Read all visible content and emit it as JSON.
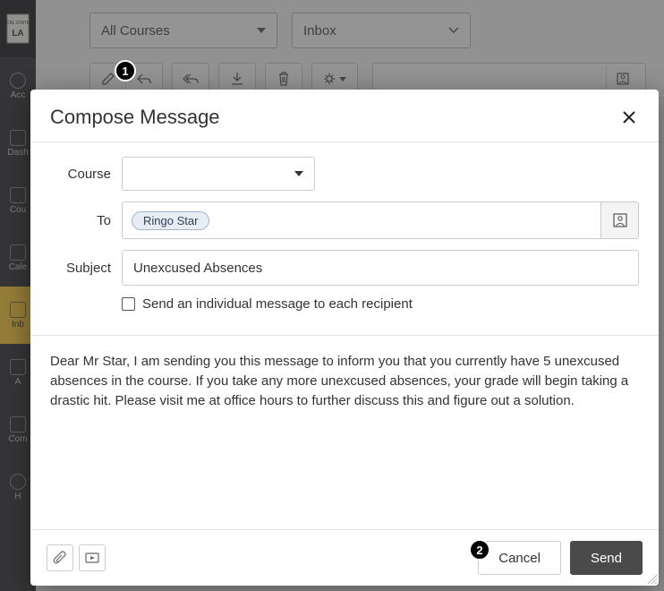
{
  "sidebar": {
    "items": [
      {
        "label": "Acc"
      },
      {
        "label": "Dash"
      },
      {
        "label": "Cou"
      },
      {
        "label": "Cale"
      },
      {
        "label": "Inb"
      },
      {
        "label": "A"
      },
      {
        "label": "Com"
      },
      {
        "label": "H"
      }
    ]
  },
  "topbar": {
    "courses_filter": "All Courses",
    "inbox_filter": "Inbox"
  },
  "callouts": {
    "one": "1",
    "two": "2"
  },
  "modal": {
    "title": "Compose Message",
    "labels": {
      "course": "Course",
      "to": "To",
      "subject": "Subject"
    },
    "recipient": "Ringo Star",
    "subject_value": "Unexcused Absences",
    "individual_checkbox": "Send an individual message to each recipient",
    "body": "Dear Mr Star, I am sending you this message to inform you that you currently have 5 unexcused absences in the course. If you take any more unexcused absences, your grade will begin taking a drastic hit. Please visit me at office hours to further discuss this and figure out a solution.",
    "buttons": {
      "cancel": "Cancel",
      "send": "Send"
    }
  }
}
